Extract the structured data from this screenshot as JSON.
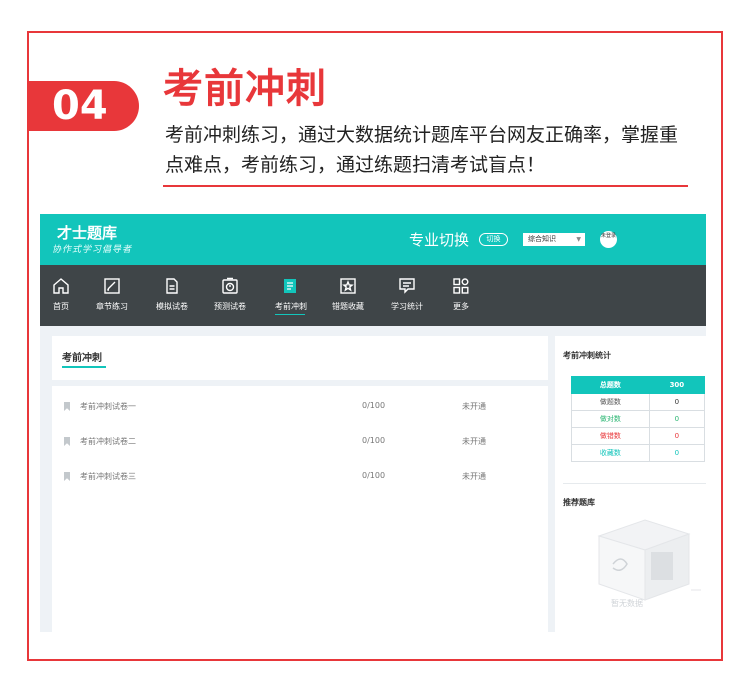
{
  "section": {
    "number": "04",
    "title": "考前冲刺",
    "description": "考前冲刺练习，通过大数据统计题库平台网友正确率，掌握重点难点，考前练习，通过练题扫清考试盲点！"
  },
  "app": {
    "logo_main": "才士题库",
    "logo_sub": "协作式学习倡导者",
    "major_title": "专业切换",
    "switch_label": "切换",
    "select_value": "综合知识",
    "avatar_text": "未登录",
    "nav": [
      {
        "label": "首页",
        "icon": "home-icon"
      },
      {
        "label": "章节练习",
        "icon": "edit-icon"
      },
      {
        "label": "模拟试卷",
        "icon": "document-icon"
      },
      {
        "label": "预测试卷",
        "icon": "timer-icon"
      },
      {
        "label": "考前冲刺",
        "icon": "notes-icon"
      },
      {
        "label": "错题收藏",
        "icon": "star-icon"
      },
      {
        "label": "学习统计",
        "icon": "chart-icon"
      },
      {
        "label": "更多",
        "icon": "grid-icon"
      }
    ],
    "active_nav": "考前冲刺",
    "panel_title": "考前冲刺",
    "papers": [
      {
        "name": "考前冲刺试卷一",
        "score": "0/100",
        "status": "未开通"
      },
      {
        "name": "考前冲刺试卷二",
        "score": "0/100",
        "status": "未开通"
      },
      {
        "name": "考前冲刺试卷三",
        "score": "0/100",
        "status": "未开通"
      }
    ],
    "side": {
      "stats_title": "考前冲刺统计",
      "stats": [
        {
          "label": "总题数",
          "value": "300"
        },
        {
          "label": "做题数",
          "value": "0"
        },
        {
          "label": "做对数",
          "value": "0"
        },
        {
          "label": "做错数",
          "value": "0"
        },
        {
          "label": "收藏数",
          "value": "0"
        }
      ],
      "recommend_title": "推荐题库",
      "empty_text": "暂无数据"
    }
  },
  "colors": {
    "accent_red": "#e8373a",
    "brand_teal": "#12c5bb",
    "nav_dark": "#3f4548",
    "stat_green": "#2bb673",
    "stat_red": "#e8373a"
  }
}
